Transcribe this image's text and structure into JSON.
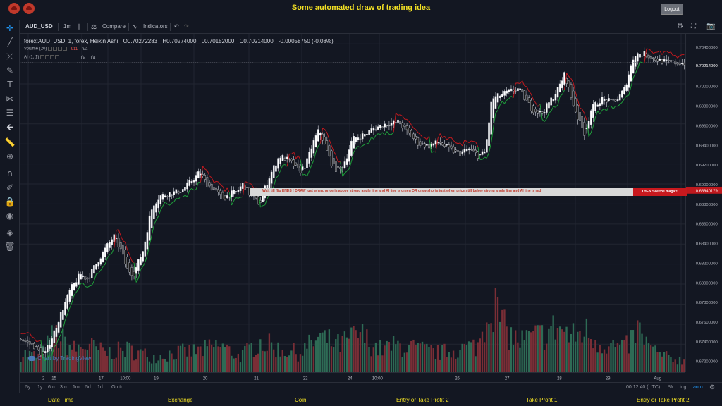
{
  "app": {
    "title": "Some automated draw of trading idea",
    "logout_label": "Logout"
  },
  "toolbar": {
    "symbol": "AUD_USD",
    "interval": "1m",
    "compare_label": "Compare",
    "indicators_label": "Indicators"
  },
  "legend": {
    "symbol_full": "forex:AUD_USD, 1, forex, Heikin Ashi",
    "open": "O0.70272283",
    "high": "H0.70274000",
    "low": "L0.70152000",
    "close": "C0.70214000",
    "change": "-0.00058750 (-0.08%)",
    "volume_label": "Volume (20)",
    "volume_value": "911",
    "volume_na": "n/a",
    "ai_label": "AI (1, 1)",
    "ai_na1": "n/a",
    "ai_na2": "n/a"
  },
  "banner": {
    "text": "Wait till flip ENDS  !    DRAW just when:  price is above strong angle line and AI line is green         OR         draw shorts just when price still below strong angle line and AI line is red",
    "cta": "THEN See the magic!!"
  },
  "watermark": "Chart by TradingView",
  "price_axis": {
    "labels": [
      "0.70400000",
      "0.70214000",
      "0.70000000",
      "0.69800000",
      "0.69600000",
      "0.69400000",
      "0.69200000",
      "0.69000000",
      "0.68800000",
      "0.68600000",
      "0.68400000",
      "0.68200000",
      "0.68000000",
      "0.67800000",
      "0.67600000",
      "0.67400000",
      "0.67200000"
    ],
    "current_price": "0.70214000",
    "line_price": "0.68940179"
  },
  "time_axis": {
    "labels": [
      "15",
      "17",
      "10:00",
      "19",
      "20",
      "21",
      "22",
      "24",
      "10:00",
      "26",
      "27",
      "28",
      "29",
      "Aug",
      "2"
    ]
  },
  "bottom_toolbar": {
    "ranges": [
      "5y",
      "1y",
      "6m",
      "3m",
      "1m",
      "5d",
      "1d"
    ],
    "goto_label": "Go to...",
    "time": "00:12:40 (UTC)",
    "percent": "%",
    "log": "log",
    "auto": "auto"
  },
  "footer": {
    "labels": [
      "Date Time",
      "Exchange",
      "Coin",
      "Entry or Take Profit 2",
      "Take Profit 1",
      "Entry or Take Profit 2"
    ]
  },
  "colors": {
    "up": "#26a69a",
    "down": "#ef5350",
    "candle_up": "#ffffff",
    "candle_down": "#1a1a1a",
    "ai_green": "#1e9e3a",
    "ai_red": "#c0191e",
    "title": "#f2e024"
  },
  "chart_data": {
    "type": "candlestick",
    "style": "Heikin Ashi",
    "symbol": "forex:AUD_USD",
    "ylim": [
      0.6712,
      0.705
    ],
    "close_path": [
      [
        0,
        0.6745
      ],
      [
        0.02,
        0.6738
      ],
      [
        0.035,
        0.6728
      ],
      [
        0.05,
        0.6752
      ],
      [
        0.06,
        0.677
      ],
      [
        0.075,
        0.6795
      ],
      [
        0.09,
        0.681
      ],
      [
        0.1,
        0.6805
      ],
      [
        0.115,
        0.6822
      ],
      [
        0.13,
        0.6838
      ],
      [
        0.14,
        0.6848
      ],
      [
        0.15,
        0.6835
      ],
      [
        0.16,
        0.6815
      ],
      [
        0.17,
        0.681
      ],
      [
        0.185,
        0.6835
      ],
      [
        0.195,
        0.687
      ],
      [
        0.2,
        0.688
      ],
      [
        0.21,
        0.6888
      ],
      [
        0.22,
        0.689
      ],
      [
        0.235,
        0.6892
      ],
      [
        0.245,
        0.6895
      ],
      [
        0.26,
        0.6905
      ],
      [
        0.27,
        0.6912
      ],
      [
        0.28,
        0.69
      ],
      [
        0.29,
        0.6895
      ],
      [
        0.305,
        0.6885
      ],
      [
        0.315,
        0.689
      ],
      [
        0.325,
        0.6892
      ],
      [
        0.335,
        0.69
      ],
      [
        0.345,
        0.689
      ],
      [
        0.36,
        0.688
      ],
      [
        0.37,
        0.69
      ],
      [
        0.38,
        0.6915
      ],
      [
        0.39,
        0.6928
      ],
      [
        0.4,
        0.6925
      ],
      [
        0.41,
        0.692
      ],
      [
        0.42,
        0.6912
      ],
      [
        0.43,
        0.692
      ],
      [
        0.44,
        0.694
      ],
      [
        0.45,
        0.6955
      ],
      [
        0.46,
        0.6935
      ],
      [
        0.47,
        0.6918
      ],
      [
        0.48,
        0.6912
      ],
      [
        0.49,
        0.6925
      ],
      [
        0.5,
        0.6945
      ],
      [
        0.52,
        0.695
      ],
      [
        0.53,
        0.6955
      ],
      [
        0.55,
        0.696
      ],
      [
        0.57,
        0.6962
      ],
      [
        0.585,
        0.695
      ],
      [
        0.6,
        0.694
      ],
      [
        0.615,
        0.6938
      ],
      [
        0.63,
        0.6942
      ],
      [
        0.645,
        0.6935
      ],
      [
        0.66,
        0.693
      ],
      [
        0.675,
        0.6935
      ],
      [
        0.69,
        0.6928
      ],
      [
        0.7,
        0.6932
      ],
      [
        0.71,
        0.6985
      ],
      [
        0.72,
        0.6988
      ],
      [
        0.735,
        0.6992
      ],
      [
        0.75,
        0.6995
      ],
      [
        0.76,
        0.6985
      ],
      [
        0.77,
        0.6975
      ],
      [
        0.785,
        0.697
      ],
      [
        0.8,
        0.6985
      ],
      [
        0.81,
        0.6995
      ],
      [
        0.82,
        0.701
      ],
      [
        0.83,
        0.6985
      ],
      [
        0.84,
        0.6965
      ],
      [
        0.85,
        0.695
      ],
      [
        0.86,
        0.6975
      ],
      [
        0.875,
        0.6985
      ],
      [
        0.89,
        0.6982
      ],
      [
        0.9,
        0.6985
      ],
      [
        0.91,
        0.6995
      ],
      [
        0.925,
        0.703
      ],
      [
        0.94,
        0.703
      ],
      [
        0.955,
        0.7025
      ],
      [
        0.97,
        0.7022
      ],
      [
        0.985,
        0.7021
      ]
    ],
    "volume_path": [
      [
        0,
        0.25
      ],
      [
        0.03,
        0.2
      ],
      [
        0.05,
        0.5
      ],
      [
        0.08,
        0.3
      ],
      [
        0.1,
        0.35
      ],
      [
        0.13,
        0.25
      ],
      [
        0.16,
        0.3
      ],
      [
        0.2,
        0.2
      ],
      [
        0.23,
        0.25
      ],
      [
        0.27,
        0.28
      ],
      [
        0.3,
        0.35
      ],
      [
        0.33,
        0.2
      ],
      [
        0.36,
        0.4
      ],
      [
        0.39,
        0.3
      ],
      [
        0.42,
        0.25
      ],
      [
        0.45,
        0.45
      ],
      [
        0.48,
        0.35
      ],
      [
        0.51,
        0.5
      ],
      [
        0.54,
        0.3
      ],
      [
        0.57,
        0.35
      ],
      [
        0.6,
        0.3
      ],
      [
        0.63,
        0.25
      ],
      [
        0.66,
        0.3
      ],
      [
        0.69,
        0.35
      ],
      [
        0.71,
        1.0
      ],
      [
        0.73,
        0.55
      ],
      [
        0.75,
        0.4
      ],
      [
        0.77,
        0.45
      ],
      [
        0.79,
        0.5
      ],
      [
        0.81,
        0.6
      ],
      [
        0.83,
        0.45
      ],
      [
        0.85,
        0.55
      ],
      [
        0.87,
        0.4
      ],
      [
        0.89,
        0.35
      ],
      [
        0.91,
        0.3
      ],
      [
        0.93,
        0.55
      ],
      [
        0.95,
        0.3
      ],
      [
        0.97,
        0.2
      ],
      [
        1,
        0.15
      ]
    ]
  }
}
